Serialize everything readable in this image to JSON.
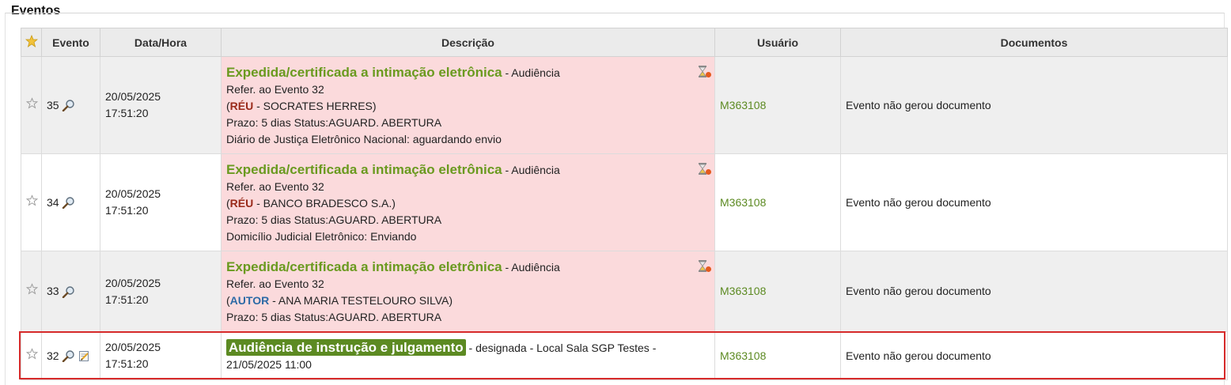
{
  "panel": {
    "title": "Eventos"
  },
  "table": {
    "headers": {
      "evento": "Evento",
      "data_hora": "Data/Hora",
      "descricao": "Descrição",
      "usuario": "Usuário",
      "documentos": "Documentos"
    },
    "rows": [
      {
        "evento": "35",
        "date": "20/05/2025",
        "time": "17:51:20",
        "desc_title": "Expedida/certificada a intimação eletrônica",
        "desc_suffix": " - Audiência",
        "line1": "Refer. ao Evento 32",
        "role": "RÉU",
        "party": " - SOCRATES HERRES)",
        "line3": "Prazo: 5 dias Status:AGUARD. ABERTURA",
        "line4": "Diário de Justiça Eletrônico Nacional: aguardando envio",
        "usuario": "M363108",
        "documentos": "Evento não gerou documento"
      },
      {
        "evento": "34",
        "date": "20/05/2025",
        "time": "17:51:20",
        "desc_title": "Expedida/certificada a intimação eletrônica",
        "desc_suffix": " - Audiência",
        "line1": "Refer. ao Evento 32",
        "role": "RÉU",
        "party": " - BANCO BRADESCO S.A.)",
        "line3": "Prazo: 5 dias Status:AGUARD. ABERTURA",
        "line4": "Domicílio Judicial Eletrônico: Enviando",
        "usuario": "M363108",
        "documentos": "Evento não gerou documento"
      },
      {
        "evento": "33",
        "date": "20/05/2025",
        "time": "17:51:20",
        "desc_title": "Expedida/certificada a intimação eletrônica",
        "desc_suffix": " - Audiência",
        "line1": "Refer. ao Evento 32",
        "role": "AUTOR",
        "party": " - ANA MARIA TESTELOURO SILVA)",
        "line3": "Prazo: 5 dias Status:AGUARD. ABERTURA",
        "usuario": "M363108",
        "documentos": "Evento não gerou documento"
      },
      {
        "evento": "32",
        "date": "20/05/2025",
        "time": "17:51:20",
        "desc_title": "Audiência de instrução e julgamento",
        "desc_suffix": " - designada - Local Sala SGP Testes -",
        "line1": "21/05/2025 11:00",
        "usuario": "M363108",
        "documentos": "Evento não gerou documento"
      }
    ]
  },
  "icons": {
    "star": "star-icon",
    "magnifier": "magnifier-icon",
    "hourglass": "hourglass-icon",
    "edit": "edit-document-icon"
  },
  "colors": {
    "title_green": "#6a9a1f",
    "highlight_green": "#5c8a22",
    "pink_row": "#fbdadc",
    "selection_border": "#d62a2a",
    "reu_color": "#9a2a1a",
    "autor_color": "#2c6aa6"
  }
}
